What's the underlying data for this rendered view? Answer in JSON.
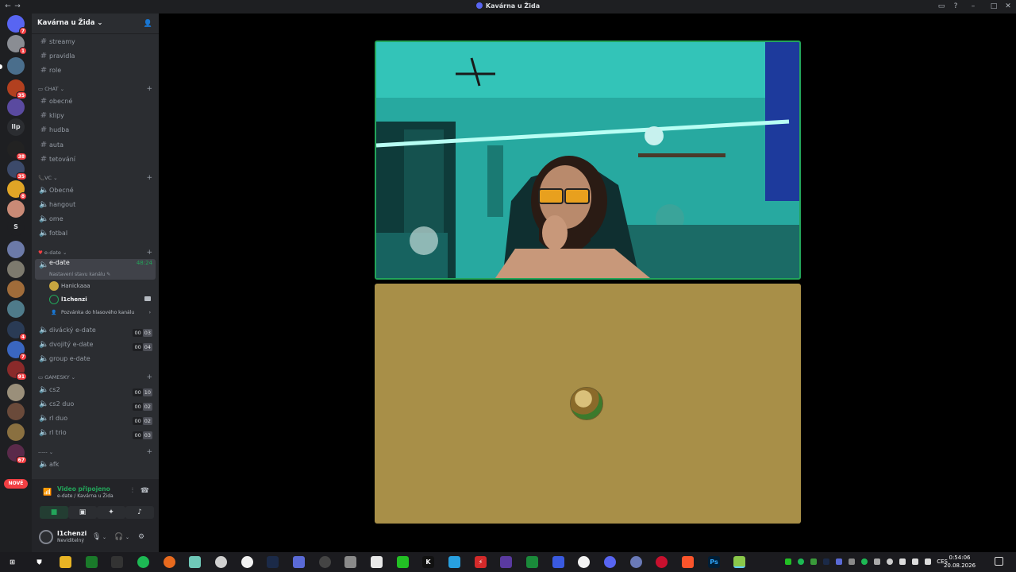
{
  "window": {
    "title": "Kavárna u Žida"
  },
  "guilds": {
    "badges": [
      "7",
      "1",
      "35",
      "38",
      "35",
      "8",
      "4",
      "7",
      "91",
      "67"
    ],
    "lp_label": "llp",
    "s_label": "S",
    "new_label": "NOVÉ"
  },
  "server": {
    "name": "Kavárna u Žida",
    "channels_top": [
      "streamy",
      "pravidla",
      "role"
    ],
    "cat_chat": "CHAT",
    "chat_channels": [
      "obecné",
      "klipy",
      "hudba",
      "auta",
      "tetování"
    ],
    "cat_vc": "VC",
    "vc_channels": [
      "Obecné",
      "hangout",
      "ome",
      "fotbal"
    ],
    "cat_edate": "e-date",
    "active_channel": {
      "name": "e-date",
      "time": "48:24",
      "status": "Nastavení stavu kanálu"
    },
    "voice_users": [
      "Hanickaaa",
      "l1chenzi"
    ],
    "invite_label": "Pozvánka do hlasového kanálu",
    "edate_channels": [
      {
        "name": "divácký e-date",
        "a": "00",
        "b": "03"
      },
      {
        "name": "dvojitý e-date",
        "a": "00",
        "b": "04"
      },
      {
        "name": "group e-date"
      }
    ],
    "cat_gamesky": "GAMESKY",
    "game_channels": [
      {
        "name": "cs2",
        "a": "00",
        "b": "10"
      },
      {
        "name": "cs2 duo",
        "a": "00",
        "b": "02"
      },
      {
        "name": "rl duo",
        "a": "00",
        "b": "02"
      },
      {
        "name": "rl trio",
        "a": "00",
        "b": "03"
      }
    ],
    "cat_misc": "-----",
    "afk_channel": "afk"
  },
  "voice_panel": {
    "status": "Video připojeno",
    "location": "e-date / Kavárna u Žida"
  },
  "user": {
    "name": "l1chenzi",
    "status": "Neviditelný"
  },
  "clock": {
    "time": "0:54:06",
    "date": "20.08.2026"
  },
  "tray": {
    "lang": "CES"
  },
  "colors": {
    "accent_green": "#23a55a",
    "avatar_tile": "#a88f48",
    "video_tint": "#1fa39a"
  }
}
